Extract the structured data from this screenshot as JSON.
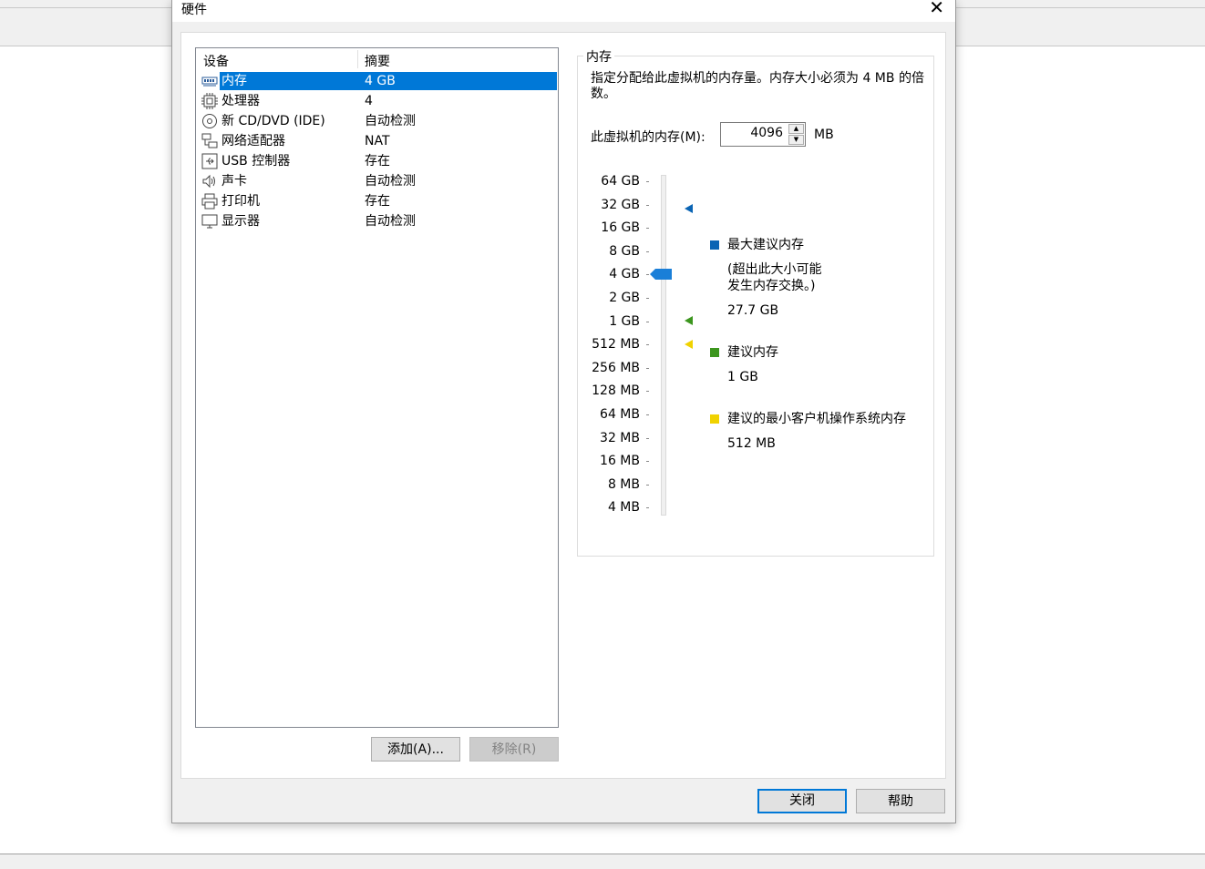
{
  "dialog": {
    "title": "硬件",
    "close_glyph": "✕"
  },
  "device_list": {
    "col_device": "设备",
    "col_summary": "摘要",
    "items": [
      {
        "name": "内存",
        "summary": "4 GB",
        "icon": "memory-icon"
      },
      {
        "name": "处理器",
        "summary": "4",
        "icon": "cpu-icon"
      },
      {
        "name": "新 CD/DVD (IDE)",
        "summary": "自动检测",
        "icon": "cd-icon"
      },
      {
        "name": "网络适配器",
        "summary": "NAT",
        "icon": "network-icon"
      },
      {
        "name": "USB 控制器",
        "summary": "存在",
        "icon": "usb-icon"
      },
      {
        "name": "声卡",
        "summary": "自动检测",
        "icon": "speaker-icon"
      },
      {
        "name": "打印机",
        "summary": "存在",
        "icon": "printer-icon"
      },
      {
        "name": "显示器",
        "summary": "自动检测",
        "icon": "monitor-icon"
      }
    ],
    "selected_index": 0
  },
  "buttons": {
    "add": "添加(A)...",
    "remove": "移除(R)",
    "close": "关闭",
    "help": "帮助"
  },
  "memory": {
    "group_label": "内存",
    "description": "指定分配给此虚拟机的内存量。内存大小必须为 4 MB 的倍数。",
    "field_label": "此虚拟机的内存(M):",
    "value": "4096",
    "unit": "MB",
    "scale_labels": [
      "64 GB",
      "32 GB",
      "16 GB",
      "8 GB",
      "4 GB",
      "2 GB",
      "1 GB",
      "512 MB",
      "256 MB",
      "128 MB",
      "64 MB",
      "32 MB",
      "16 MB",
      "8 MB",
      "4 MB"
    ],
    "current_level": "4 GB",
    "legend": {
      "max": {
        "title": "最大建议内存",
        "note_line1": "(超出此大小可能",
        "note_line2": "发生内存交换。)",
        "value": "27.7 GB",
        "color": "#0a64b4"
      },
      "recommended": {
        "title": "建议内存",
        "value": "1 GB",
        "color": "#3c961e"
      },
      "min_guest": {
        "title": "建议的最小客户机操作系统内存",
        "value": "512 MB",
        "color": "#f0d200"
      }
    },
    "slider_color": "#1a7fd8"
  }
}
